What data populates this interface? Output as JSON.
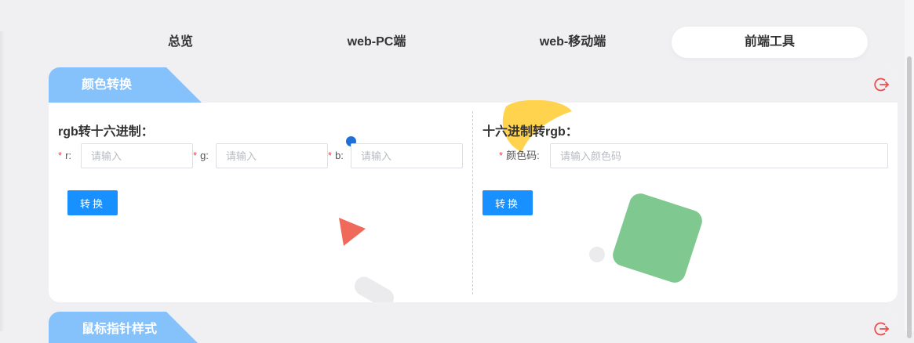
{
  "nav": {
    "tabs": [
      {
        "label": "总览",
        "active": false
      },
      {
        "label": "web-PC端",
        "active": false
      },
      {
        "label": "web-移动端",
        "active": false
      },
      {
        "label": "前端工具",
        "active": true
      }
    ]
  },
  "color_card": {
    "title": "颜色转换",
    "exit_icon": "logout-icon",
    "rgb_to_hex": {
      "title": "rgb转十六进制：",
      "fields": [
        {
          "label": "r",
          "placeholder": "请输入",
          "value": ""
        },
        {
          "label": "g",
          "placeholder": "请输入",
          "value": ""
        },
        {
          "label": "b",
          "placeholder": "请输入",
          "value": ""
        }
      ],
      "button": "转换"
    },
    "hex_to_rgb": {
      "title": "十六进制转rgb：",
      "field": {
        "label": "颜色码",
        "placeholder": "请输入颜色码",
        "value": ""
      },
      "button": "转换"
    }
  },
  "pointer_card": {
    "title": "鼠标指针样式",
    "exit_icon": "logout-icon"
  },
  "colors": {
    "primary": "#1890ff",
    "tab_blue": "#85c1fb",
    "required": "#e5484d",
    "deco_yellow": "#ffd34e",
    "deco_green": "#7fc890",
    "deco_red": "#ef6a5a",
    "deco_blue": "#1f6fd6"
  }
}
